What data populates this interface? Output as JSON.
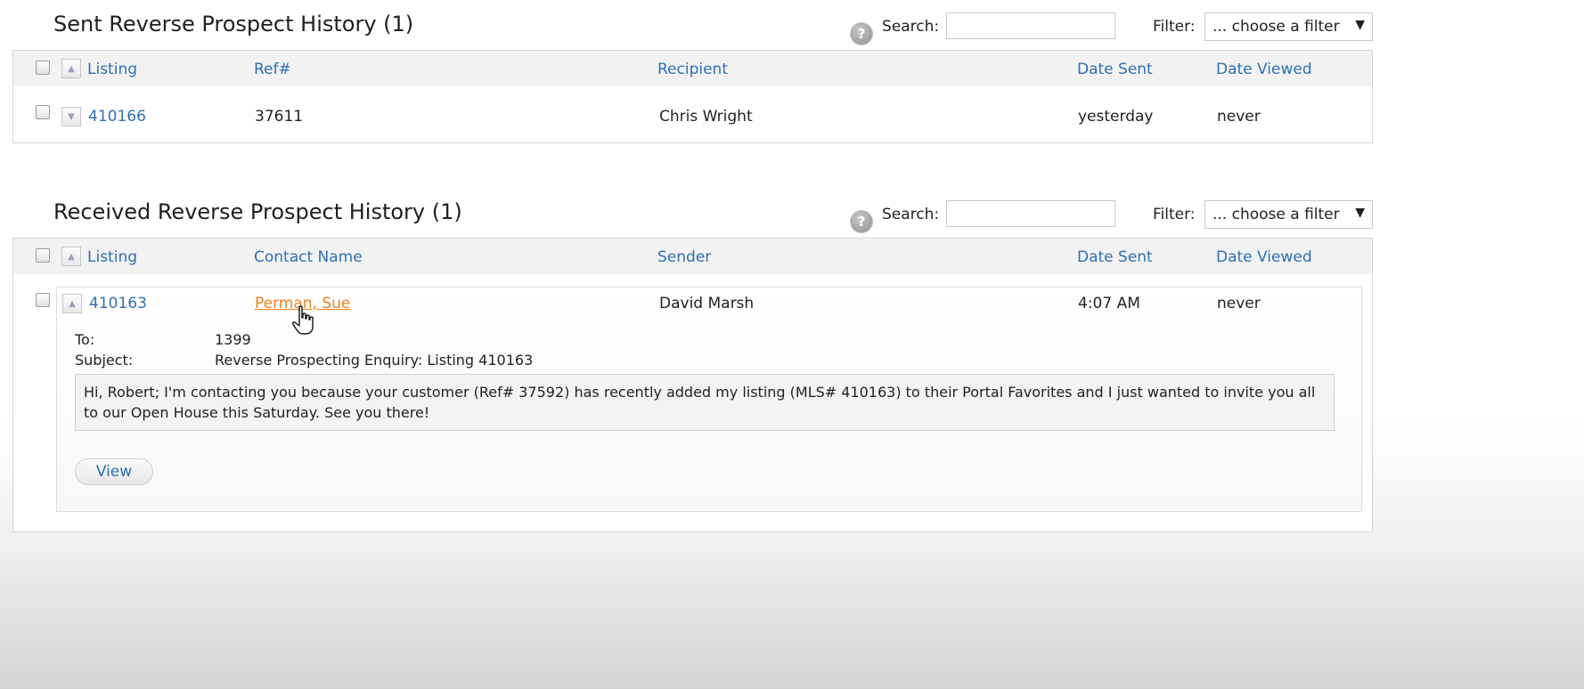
{
  "sent": {
    "title": "Sent Reverse Prospect History (1)",
    "help_icon": "?",
    "search_label": "Search:",
    "search_value": "",
    "filter_label": "Filter:",
    "filter_value": "... choose a filter",
    "columns": [
      "Listing",
      "Ref#",
      "Recipient",
      "Date Sent",
      "Date Viewed"
    ],
    "rows": [
      {
        "listing": "410166",
        "ref": "37611",
        "recipient": "Chris Wright",
        "date_sent": "yesterday",
        "date_viewed": "never"
      }
    ]
  },
  "received": {
    "title": "Received Reverse Prospect History (1)",
    "help_icon": "?",
    "search_label": "Search:",
    "search_value": "",
    "filter_label": "Filter:",
    "filter_value": "... choose a filter",
    "columns": [
      "Listing",
      "Contact Name",
      "Sender",
      "Date Sent",
      "Date Viewed"
    ],
    "rows": [
      {
        "listing": "410163",
        "contact_name": "Perman, Sue",
        "sender": "David Marsh",
        "date_sent": "4:07 AM",
        "date_viewed": "never",
        "details": {
          "to_label": "To:",
          "to_value": "1399",
          "subject_label": "Subject:",
          "subject_value": "Reverse Prospecting Enquiry: Listing 410163",
          "message": "Hi, Robert; I'm contacting you because your customer (Ref# 37592) has recently added my listing (MLS# 410163) to their Portal Favorites and I just wanted to invite you all to our Open House this Saturday. See you there!",
          "view_button": "View"
        }
      }
    ]
  },
  "colors": {
    "link": "#2f6fb5",
    "contact_link": "#e8821e",
    "header_bg": "#f2f2f2"
  }
}
